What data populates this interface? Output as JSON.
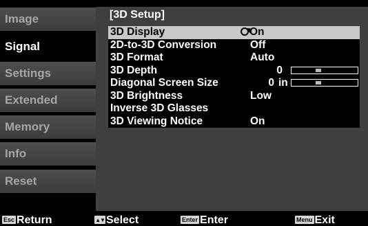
{
  "tabs": [
    {
      "label": "Image",
      "active": false
    },
    {
      "label": "Signal",
      "active": true
    },
    {
      "label": "Settings",
      "active": false
    },
    {
      "label": "Extended",
      "active": false
    },
    {
      "label": "Memory",
      "active": false
    },
    {
      "label": "Info",
      "active": false
    },
    {
      "label": "Reset",
      "active": false
    }
  ],
  "panel": {
    "title": "[3D Setup]",
    "rows": [
      {
        "label": "3D Display",
        "value": "On",
        "icon": "cycle-icon",
        "selected": true
      },
      {
        "label": "2D-to-3D Conversion",
        "value": "Off"
      },
      {
        "label": "3D Format",
        "value": "Auto"
      },
      {
        "label": "3D Depth",
        "value": "0",
        "slider_level": 0.4
      },
      {
        "label": "Diagonal Screen Size",
        "value": "0",
        "unit": "in",
        "slider_level": 0.4
      },
      {
        "label": "3D Brightness",
        "value": "Low"
      },
      {
        "label": "Inverse 3D Glasses",
        "value": ""
      },
      {
        "label": "3D Viewing Notice",
        "value": "On"
      }
    ]
  },
  "footer": {
    "return": {
      "key": "Esc",
      "label": "Return"
    },
    "select": {
      "key": "arrows-icon",
      "label": "Select"
    },
    "enter": {
      "key": "Enter",
      "label": "Enter"
    },
    "exit": {
      "key": "Menu",
      "label": "Exit"
    }
  }
}
